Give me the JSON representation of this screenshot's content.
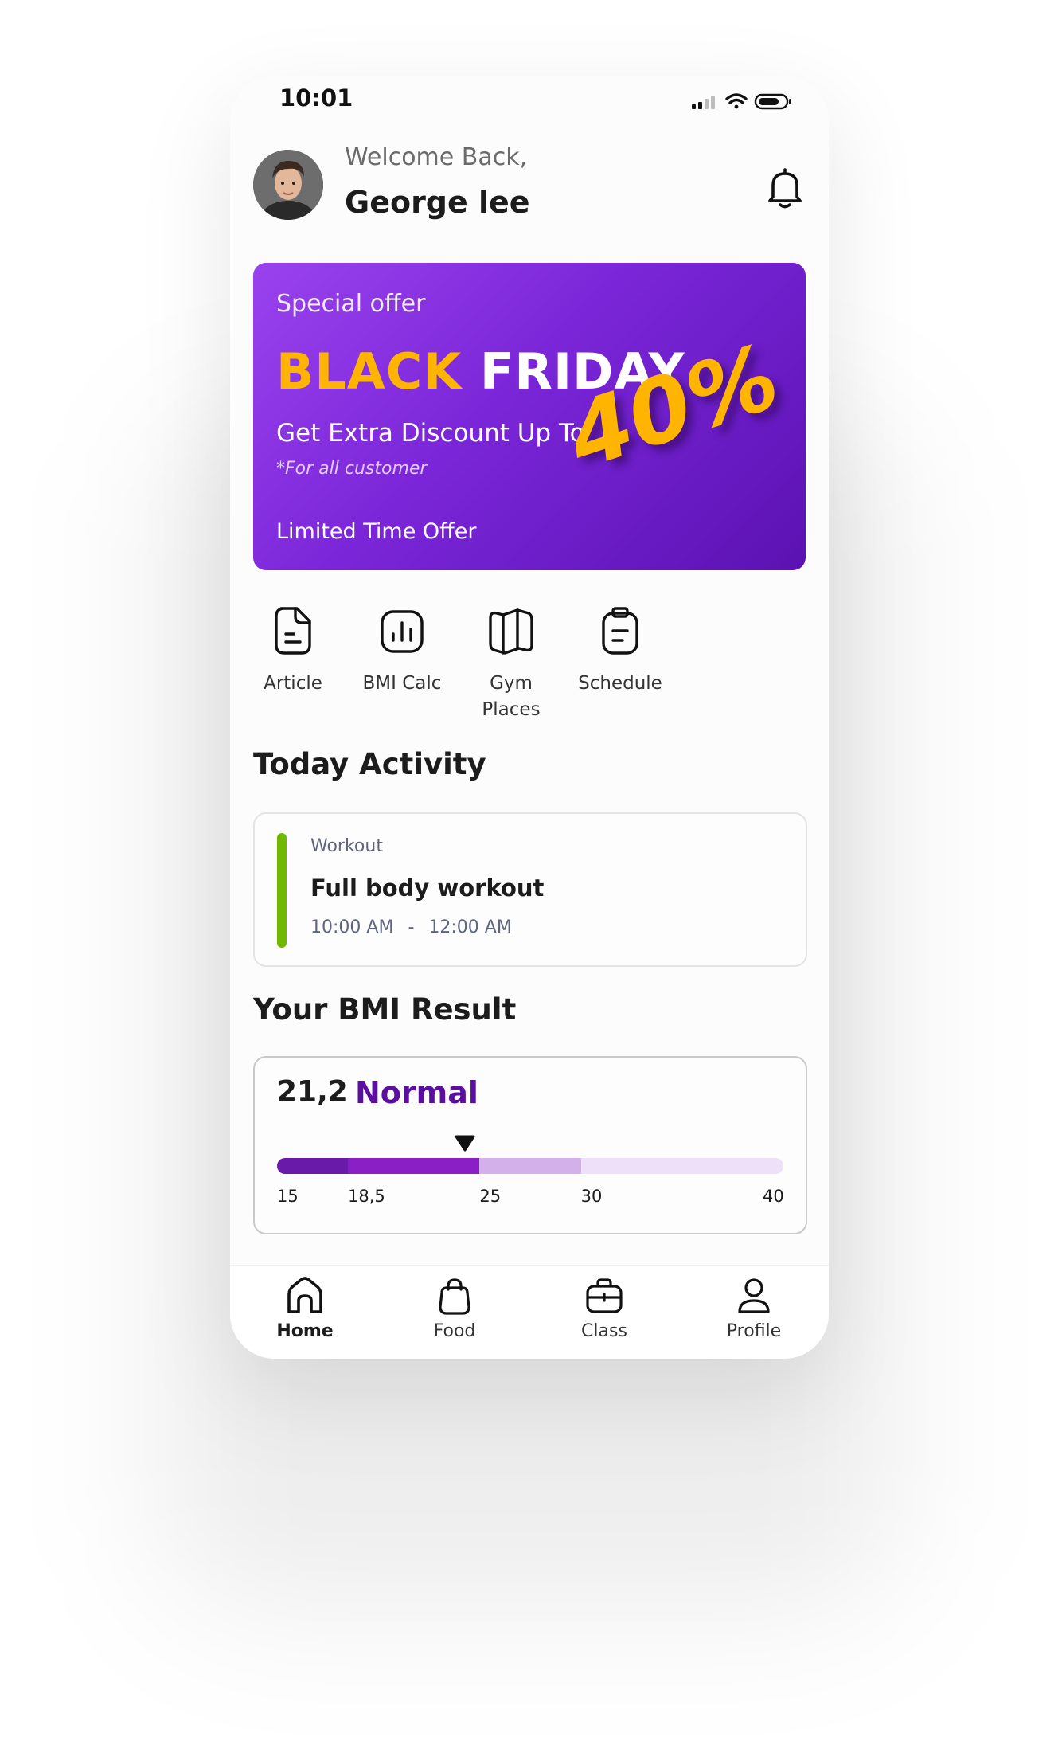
{
  "status_bar": {
    "time": "10:01"
  },
  "header": {
    "greeting": "Welcome Back,",
    "user_name": "George lee"
  },
  "promo": {
    "eyebrow": "Special offer",
    "title_highlight": "BLACK",
    "title_rest": "FRIDAY",
    "subtitle": "Get Extra Discount Up To",
    "note": "*For all customer",
    "limited": "Limited Time Offer",
    "badge": "40%",
    "accent_color": "#ffb400",
    "gradient_start": "#9a42ee",
    "gradient_end": "#5b12b2"
  },
  "shortcuts": [
    {
      "label": "Article",
      "icon": "article-icon"
    },
    {
      "label": "BMI Calc",
      "icon": "bmi-chart-icon"
    },
    {
      "label": "Gym\nPlaces",
      "icon": "map-icon"
    },
    {
      "label": "Schedule",
      "icon": "clipboard-icon"
    }
  ],
  "activity": {
    "section_title": "Today Activity",
    "category": "Workout",
    "name": "Full body workout",
    "start": "10:00 AM",
    "separator": "-",
    "end": "12:00 AM",
    "accent_color": "#71b800"
  },
  "bmi": {
    "section_title": "Your BMI Result",
    "value": "21,2",
    "status": "Normal",
    "ticks": [
      "15",
      "18,5",
      "25",
      "30",
      "40"
    ],
    "scale_min": 15,
    "scale_max": 40,
    "reading": 21.2,
    "colors": [
      "#6a1aa8",
      "#8a1fc6",
      "#d3b0ea",
      "#ede0f8"
    ]
  },
  "bottom_nav": [
    {
      "label": "Home",
      "icon": "home-icon",
      "active": true
    },
    {
      "label": "Food",
      "icon": "bag-icon",
      "active": false
    },
    {
      "label": "Class",
      "icon": "briefcase-icon",
      "active": false
    },
    {
      "label": "Profile",
      "icon": "user-icon",
      "active": false
    }
  ]
}
